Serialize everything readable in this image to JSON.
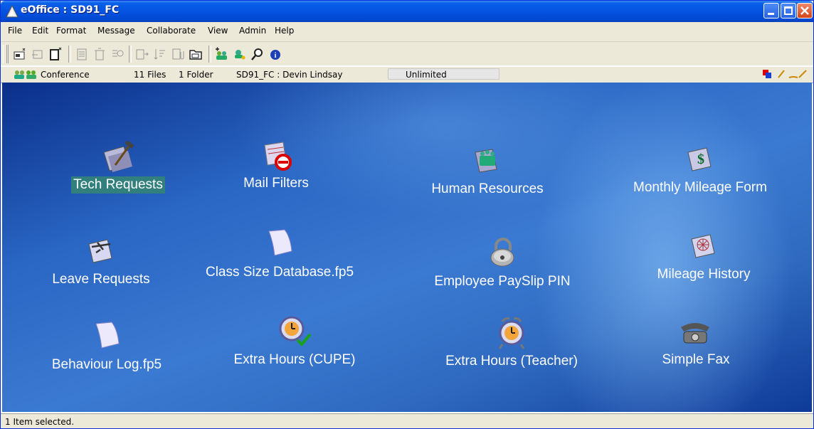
{
  "window": {
    "title": "eOffice : SD91_FC",
    "controls": [
      "minimize",
      "maximize",
      "close"
    ]
  },
  "menu": [
    "File",
    "Edit",
    "Format",
    "Message",
    "Collaborate",
    "View",
    "Admin",
    "Help"
  ],
  "toolbar": {
    "groups": [
      [
        "new-message-icon",
        "reply-icon",
        "new-document-icon"
      ],
      [
        "paste-icon",
        "delete-icon",
        "properties-icon"
      ],
      [
        "forward-icon",
        "sort-icon",
        "attach-icon",
        "folder-icon"
      ],
      [
        "add-user-icon",
        "key-user-icon",
        "search-icon",
        "info-icon"
      ]
    ]
  },
  "infobar": {
    "conference_label": "Conference",
    "files": "11 Files",
    "folders": "1 Folder",
    "path": "SD91_FC : Devin Lindsay",
    "quota": "Unlimited",
    "right_icons": [
      "windows-icon",
      "pencil-icon",
      "write-icon"
    ]
  },
  "items": [
    {
      "label": "Tech Requests",
      "icon": "folder-hammer-icon",
      "selected": true
    },
    {
      "label": "Mail Filters",
      "icon": "mail-filter-icon",
      "selected": false
    },
    {
      "label": "Human Resources",
      "icon": "people-folder-icon",
      "selected": false
    },
    {
      "label": "Monthly Mileage Form",
      "icon": "dollar-folder-icon",
      "selected": false
    },
    {
      "label": "Leave Requests",
      "icon": "plane-folder-icon",
      "selected": false
    },
    {
      "label": "Class Size Database.fp5",
      "icon": "document-icon",
      "selected": false
    },
    {
      "label": "Employee PaySlip PIN",
      "icon": "padlock-icon",
      "selected": false
    },
    {
      "label": "Mileage History",
      "icon": "web-folder-icon",
      "selected": false
    },
    {
      "label": "Behaviour Log.fp5",
      "icon": "document-icon",
      "selected": false
    },
    {
      "label": "Extra Hours (CUPE)",
      "icon": "clock-check-icon",
      "selected": false
    },
    {
      "label": "Extra Hours (Teacher)",
      "icon": "alarm-clock-icon",
      "selected": false
    },
    {
      "label": "Simple Fax",
      "icon": "telephone-icon",
      "selected": false
    }
  ],
  "status": "1 Item selected."
}
